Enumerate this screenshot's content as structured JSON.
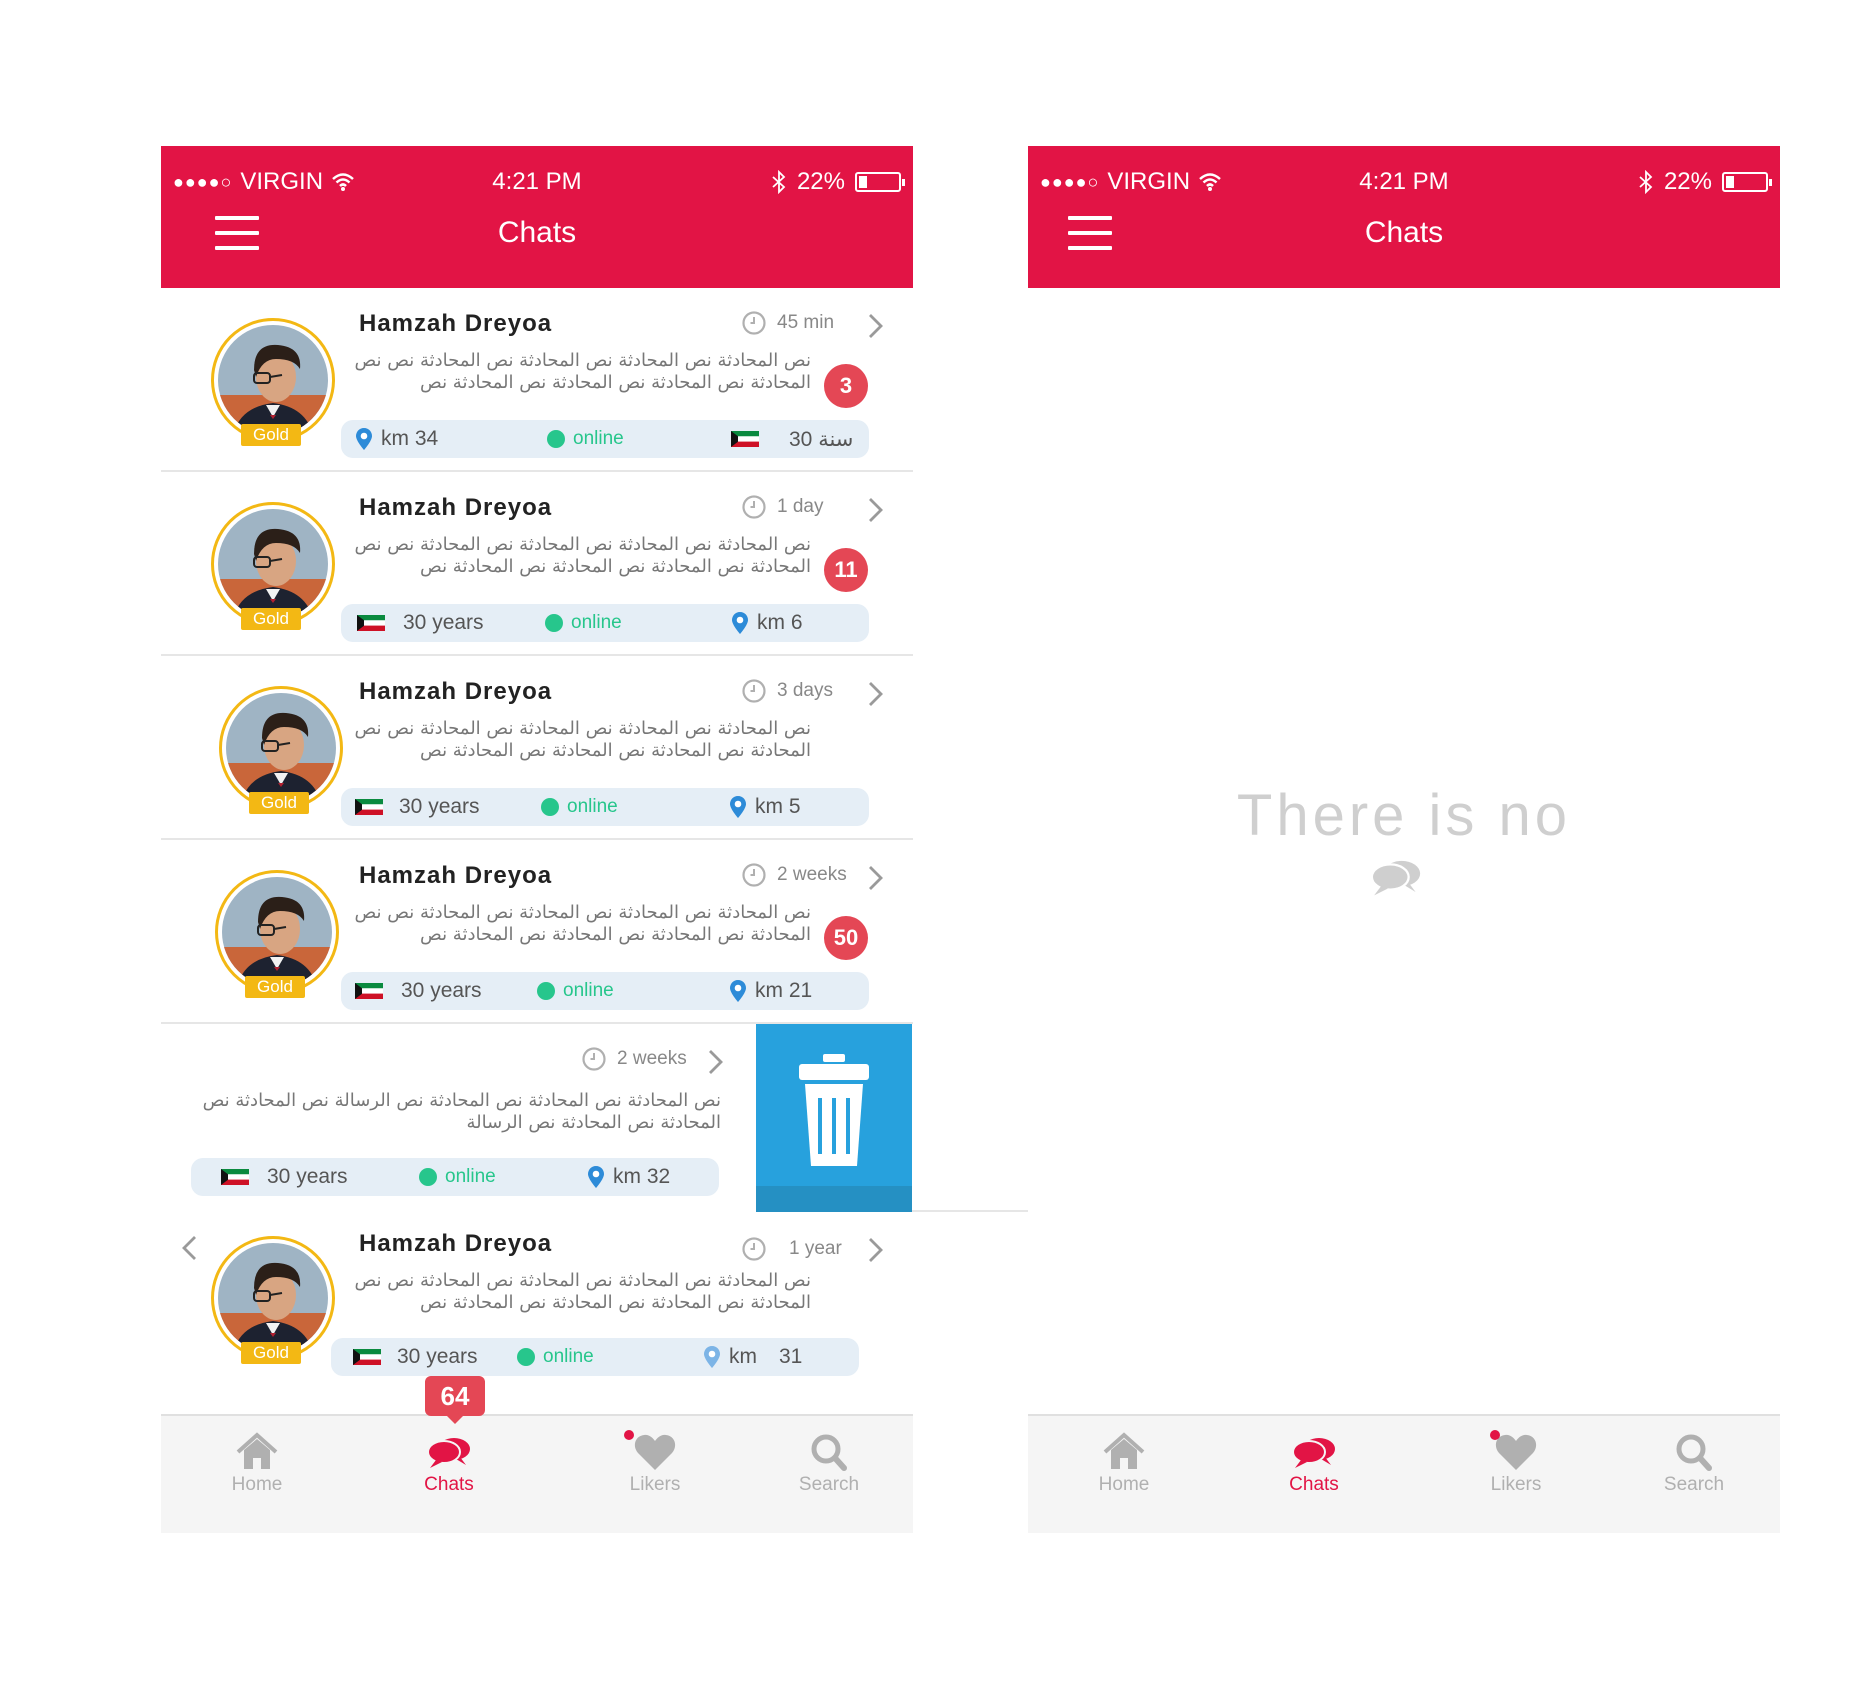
{
  "status_bar": {
    "signal_dots": "●●●●○",
    "carrier": "VIRGIN",
    "time": "4:21 PM",
    "battery": "22%",
    "battery_level": 0.22
  },
  "header": {
    "title": "Chats"
  },
  "chats": [
    {
      "name": "Hamzah Dreyoa",
      "badge": "Gold",
      "time": "45 min",
      "message": "نص المحادثة نص المحادثة نص المحادثة نص المحادثة نص نص المحادثة نص المحادثة نص المحادثة نص المحادثة نص",
      "unread": "3",
      "age": "30 سنة",
      "status": "online",
      "distance": "km 34"
    },
    {
      "name": "Hamzah Dreyoa",
      "badge": "Gold",
      "time": "1 day",
      "message": "نص المحادثة نص المحادثة نص المحادثة نص المحادثة نص نص المحادثة نص المحادثة نص المحادثة نص المحادثة نص",
      "unread": "11",
      "age": "30 years",
      "status": "online",
      "distance": "km 6"
    },
    {
      "name": "Hamzah Dreyoa",
      "badge": "Gold",
      "time": "3 days",
      "message": "نص المحادثة نص المحادثة نص المحادثة نص المحادثة نص نص المحادثة نص المحادثة نص المحادثة نص المحادثة نص",
      "unread": "",
      "age": "30 years",
      "status": "online",
      "distance": "km 5"
    },
    {
      "name": "Hamzah Dreyoa",
      "badge": "Gold",
      "time": "2 weeks",
      "message": "نص المحادثة نص المحادثة نص المحادثة نص المحادثة نص نص المحادثة نص المحادثة نص المحادثة نص المحادثة نص",
      "unread": "50",
      "age": "30 years",
      "status": "online",
      "distance": "km 21"
    }
  ],
  "swiped_chat": {
    "time": "2 weeks",
    "message": "نص المحادثة نص المحادثة نص المحادثة نص الرسالة نص المحادثة نص المحادثة نص المحادثة نص الرسالة",
    "age": "30 years",
    "status": "online",
    "distance": "km 32"
  },
  "last_chat": {
    "name": "Hamzah Dreyoa",
    "badge": "Gold",
    "time": "1 year",
    "message": "نص المحادثة نص المحادثة نص المحادثة نص المحادثة نص نص المحادثة نص المحادثة نص المحادثة نص المحادثة نص",
    "age": "30  years",
    "status": "online",
    "distance_unit": "km",
    "distance_value": "31"
  },
  "bottom_nav": {
    "home": "Home",
    "chats": "Chats",
    "likers": "Likers",
    "search": "Search",
    "chats_badge": "64"
  },
  "empty_state": {
    "text": "There is no"
  },
  "colors": {
    "brand_red": "#e21445",
    "gold": "#f3b814",
    "online_green": "#27c68c",
    "unread_red": "#e44755",
    "delete_blue": "#27a1dd",
    "info_bar": "#e5eef6"
  },
  "icons": [
    "menu-icon",
    "wifi-icon",
    "bluetooth-icon",
    "battery-icon",
    "clock-icon",
    "chevron-right-icon",
    "chevron-left-icon",
    "location-pin-icon",
    "kuwait-flag-icon",
    "trash-icon",
    "home-icon",
    "chat-bubbles-icon",
    "heart-icon",
    "search-icon"
  ]
}
